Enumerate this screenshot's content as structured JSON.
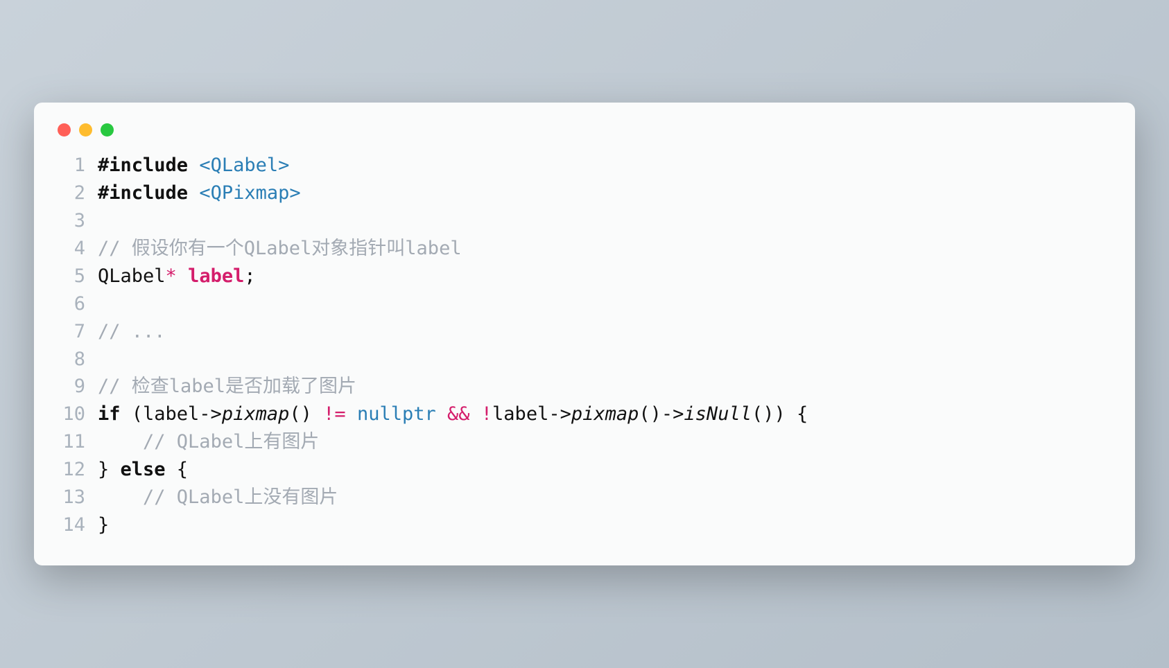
{
  "code": {
    "lines": [
      {
        "n": "1",
        "segs": [
          [
            "c-hash",
            "#"
          ],
          [
            "c-directive",
            "include"
          ],
          [
            "c-normal",
            " "
          ],
          [
            "c-include",
            "<QLabel>"
          ]
        ]
      },
      {
        "n": "2",
        "segs": [
          [
            "c-hash",
            "#"
          ],
          [
            "c-directive",
            "include"
          ],
          [
            "c-normal",
            " "
          ],
          [
            "c-include",
            "<QPixmap>"
          ]
        ]
      },
      {
        "n": "3",
        "segs": []
      },
      {
        "n": "4",
        "segs": [
          [
            "c-comment",
            "// 假设你有一个QLabel对象指针叫label"
          ]
        ]
      },
      {
        "n": "5",
        "segs": [
          [
            "c-type",
            "QLabel"
          ],
          [
            "c-star",
            "*"
          ],
          [
            "c-normal",
            " "
          ],
          [
            "c-decl",
            "label"
          ],
          [
            "c-normal",
            ";"
          ]
        ]
      },
      {
        "n": "6",
        "segs": []
      },
      {
        "n": "7",
        "segs": [
          [
            "c-comment",
            "// ..."
          ]
        ]
      },
      {
        "n": "8",
        "segs": []
      },
      {
        "n": "9",
        "segs": [
          [
            "c-comment",
            "// 检查label是否加载了图片"
          ]
        ]
      },
      {
        "n": "10",
        "segs": [
          [
            "c-keyword",
            "if"
          ],
          [
            "c-normal",
            " (label->"
          ],
          [
            "c-method",
            "pixmap"
          ],
          [
            "c-normal",
            "() "
          ],
          [
            "c-op",
            "!="
          ],
          [
            "c-normal",
            " "
          ],
          [
            "c-builtin",
            "nullptr"
          ],
          [
            "c-normal",
            " "
          ],
          [
            "c-op",
            "&&"
          ],
          [
            "c-normal",
            " "
          ],
          [
            "c-op",
            "!"
          ],
          [
            "c-normal",
            "label->"
          ],
          [
            "c-method",
            "pixmap"
          ],
          [
            "c-normal",
            "()->"
          ],
          [
            "c-method",
            "isNull"
          ],
          [
            "c-normal",
            "()) {"
          ]
        ]
      },
      {
        "n": "11",
        "segs": [
          [
            "c-normal",
            "    "
          ],
          [
            "c-comment",
            "// QLabel上有图片"
          ]
        ]
      },
      {
        "n": "12",
        "segs": [
          [
            "c-normal",
            "} "
          ],
          [
            "c-keyword",
            "else"
          ],
          [
            "c-normal",
            " {"
          ]
        ]
      },
      {
        "n": "13",
        "segs": [
          [
            "c-normal",
            "    "
          ],
          [
            "c-comment",
            "// QLabel上没有图片"
          ]
        ]
      },
      {
        "n": "14",
        "segs": [
          [
            "c-normal",
            "}"
          ]
        ]
      }
    ]
  }
}
